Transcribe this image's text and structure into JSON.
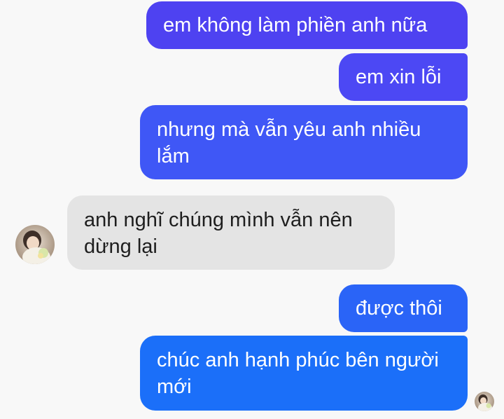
{
  "conversation": {
    "messages": [
      {
        "sender": "me",
        "text": "em không làm phiền anh nữa"
      },
      {
        "sender": "me",
        "text": "em xin lỗi"
      },
      {
        "sender": "me",
        "text": "nhưng mà vẫn yêu anh nhiều lắm"
      },
      {
        "sender": "contact",
        "text": "anh nghĩ chúng mình vẫn nên dừng lại"
      },
      {
        "sender": "me",
        "text": "được thôi"
      },
      {
        "sender": "me",
        "text": "chúc anh hạnh phúc bên người mới"
      }
    ],
    "contact_avatar_icon": "contact-avatar-icon",
    "read_receipt_icon": "read-receipt-avatar-icon"
  },
  "colors": {
    "background": "#f8f8f8",
    "incoming_bubble": "#e4e4e4",
    "outgoing_gradient_top": "#4e42f1",
    "outgoing_gradient_bottom": "#1b6ff9"
  }
}
